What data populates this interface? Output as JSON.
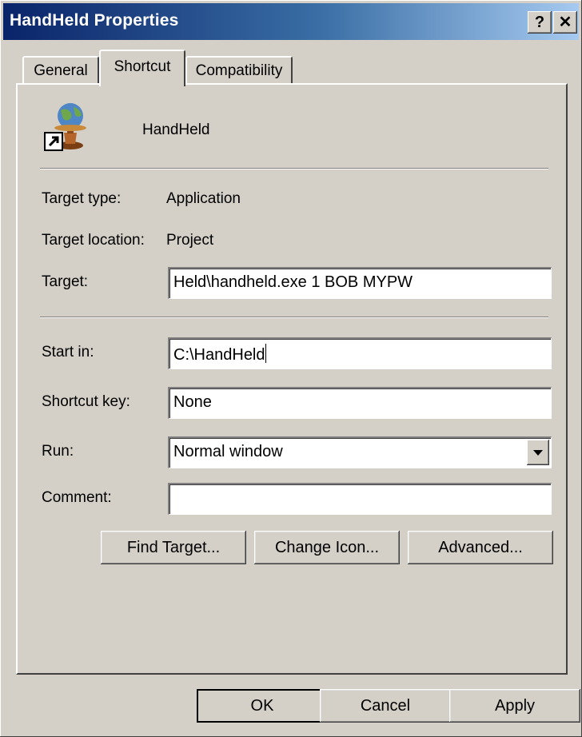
{
  "window": {
    "title": "HandHeld Properties",
    "help_label": "?",
    "close_label": "✕"
  },
  "tabs": [
    {
      "label": "General",
      "active": false
    },
    {
      "label": "Shortcut",
      "active": true
    },
    {
      "label": "Compatibility",
      "active": false
    }
  ],
  "shortcut": {
    "name": "HandHeld",
    "target_type_label": "Target type:",
    "target_type_value": "Application",
    "target_location_label": "Target location:",
    "target_location_value": "Project",
    "target_label": "Target:",
    "target_value": "Held\\handheld.exe 1 BOB MYPW",
    "start_in_label": "Start in:",
    "start_in_value": "C:\\HandHeld",
    "shortcut_key_label": "Shortcut key:",
    "shortcut_key_value": "None",
    "run_label": "Run:",
    "run_value": "Normal window",
    "comment_label": "Comment:",
    "comment_value": "",
    "find_target_label": "Find Target...",
    "change_icon_label": "Change Icon...",
    "advanced_label": "Advanced..."
  },
  "footer": {
    "ok_label": "OK",
    "cancel_label": "Cancel",
    "apply_label": "Apply"
  },
  "colors": {
    "face": "#d4d0c8",
    "title_start": "#0a246a",
    "title_end": "#a6caf0"
  },
  "icons": {
    "app_icon": "globe-shortcut-icon",
    "dropdown": "chevron-down-icon"
  }
}
